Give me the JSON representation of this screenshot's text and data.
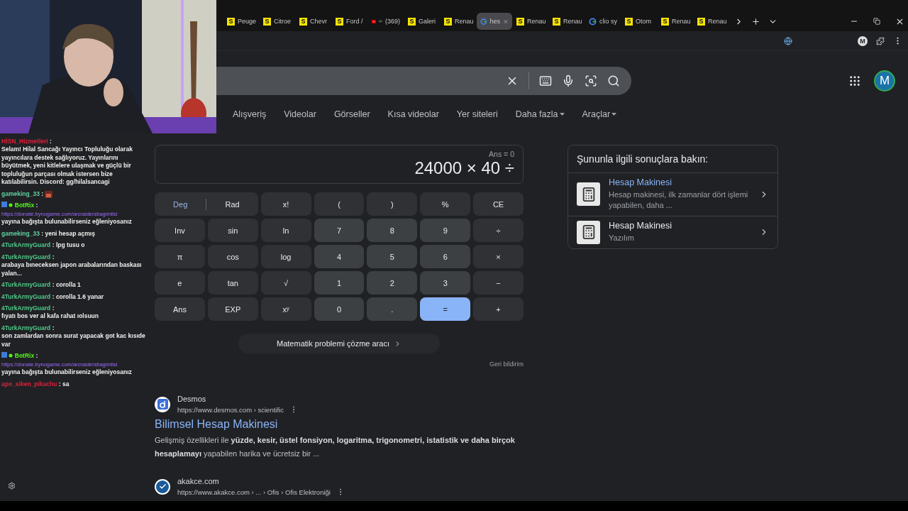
{
  "tabs": [
    {
      "kind": "site",
      "favicon": "S",
      "label": "Peuge",
      "selected": false
    },
    {
      "kind": "site",
      "favicon": "S",
      "label": "Citroe",
      "selected": false
    },
    {
      "kind": "site",
      "favicon": "S",
      "label": "Chevr",
      "selected": false
    },
    {
      "kind": "site",
      "favicon": "S",
      "label": "Ford /",
      "selected": false
    },
    {
      "kind": "video",
      "label": "(369)",
      "selected": false
    },
    {
      "kind": "site",
      "favicon": "S",
      "label": "Galeri",
      "selected": false
    },
    {
      "kind": "site",
      "favicon": "S",
      "label": "Renau",
      "selected": false
    },
    {
      "kind": "search",
      "label": "hes",
      "selected": true
    },
    {
      "kind": "site",
      "favicon": "S",
      "label": "Renau",
      "selected": false
    },
    {
      "kind": "site",
      "favicon": "S",
      "label": "Renau",
      "selected": false
    },
    {
      "kind": "search",
      "label": "clio sy",
      "selected": false
    },
    {
      "kind": "site",
      "favicon": "S",
      "label": "Otom",
      "selected": false
    },
    {
      "kind": "site",
      "favicon": "S",
      "label": "Renau",
      "selected": false
    },
    {
      "kind": "site",
      "favicon": "S",
      "label": "Renau",
      "selected": false
    }
  ],
  "profile_button": "M",
  "account_avatar": "M",
  "search_nav": [
    {
      "label": "Alışveriş",
      "dropdown": false
    },
    {
      "label": "Videolar",
      "dropdown": false
    },
    {
      "label": "Görseller",
      "dropdown": false
    },
    {
      "label": "Kısa videolar",
      "dropdown": false
    },
    {
      "label": "Yer siteleri",
      "dropdown": false
    },
    {
      "label": "Daha fazla",
      "dropdown": true
    },
    {
      "label": "Araçlar",
      "dropdown": true
    }
  ],
  "chat": [
    {
      "user": "HİSN_Hizmetleri",
      "color": "#e0203a",
      "separator": ":",
      "text": "Selam! Hilal Sancağı Yayıncı Topluluğu olarak yayıncılara destek sağlıyoruz. Yayınlarını büyütmek, yeni kitlelere ulaşmak ve güçlü bir topluluğun parçası olmak istersen bize katılabilirsin. Discord: gg/hilalsancagi"
    },
    {
      "user": "gameking_33",
      "color": "#5fd3a0",
      "separator": ":",
      "emote": true
    },
    {
      "user": "BotRix",
      "color": "#53fc18",
      "separator": ":",
      "bot": true,
      "link": "https://donate.bynogame.com/arcraidersbagimlisi",
      "text": "yayına bağışta bulunabilirseniz eğleniyosanız"
    },
    {
      "user": "gameking_33",
      "color": "#5fd3a0",
      "separator": ":",
      "text": "yeni hesap açmış"
    },
    {
      "user": "4TurkArmyGuard",
      "color": "#4fc98a",
      "separator": ":",
      "text": "lpg tusu o"
    },
    {
      "user": "4TurkArmyGuard",
      "color": "#4fc98a",
      "separator": ":",
      "text": "arabaya bıneceksen japon arabalarından baskası yalan..."
    },
    {
      "user": "4TurkArmyGuard",
      "color": "#4fc98a",
      "separator": ":",
      "text": "corolla 1"
    },
    {
      "user": "4TurkArmyGuard",
      "color": "#4fc98a",
      "separator": ":",
      "text": "corolla 1.6 yanar"
    },
    {
      "user": "4TurkArmyGuard",
      "color": "#4fc98a",
      "separator": ":",
      "text": "fıyatı bos ver al kafa rahat ıolsuun"
    },
    {
      "user": "4TurkArmyGuard",
      "color": "#4fc98a",
      "separator": ":",
      "text": "son zamlardan sonra surat yapacak got kac kısıde var"
    },
    {
      "user": "BotRix",
      "color": "#53fc18",
      "separator": ":",
      "bot": true,
      "link": "https://donate.bynogame.com/arcraidersbagimlisi",
      "text": "yayına bağışta bulunabilirseniz eğleniyosanız"
    },
    {
      "user": "apo_siken_pikachu",
      "color": "#e0203a",
      "separator": ":",
      "text": "sa"
    }
  ],
  "calculator": {
    "ans": "Ans = 0",
    "expression": "24000 × 40 ÷",
    "angle_modes": [
      {
        "label": "Deg",
        "selected": true
      },
      {
        "label": "Rad",
        "selected": false
      }
    ],
    "keys": [
      {
        "label": "x!",
        "kind": "fn"
      },
      {
        "label": "(",
        "kind": "fn"
      },
      {
        "label": ")",
        "kind": "fn"
      },
      {
        "label": "%",
        "kind": "fn"
      },
      {
        "label": "CE",
        "kind": "fn"
      },
      {
        "label": "Inv",
        "kind": "fn"
      },
      {
        "label": "sin",
        "kind": "fn"
      },
      {
        "label": "ln",
        "kind": "fn"
      },
      {
        "label": "7",
        "kind": "digit"
      },
      {
        "label": "8",
        "kind": "digit"
      },
      {
        "label": "9",
        "kind": "digit"
      },
      {
        "label": "÷",
        "kind": "fn"
      },
      {
        "label": "π",
        "kind": "fn"
      },
      {
        "label": "cos",
        "kind": "fn"
      },
      {
        "label": "log",
        "kind": "fn"
      },
      {
        "label": "4",
        "kind": "digit"
      },
      {
        "label": "5",
        "kind": "digit"
      },
      {
        "label": "6",
        "kind": "digit"
      },
      {
        "label": "×",
        "kind": "fn"
      },
      {
        "label": "e",
        "kind": "fn"
      },
      {
        "label": "tan",
        "kind": "fn"
      },
      {
        "label": "√",
        "kind": "fn"
      },
      {
        "label": "1",
        "kind": "digit"
      },
      {
        "label": "2",
        "kind": "digit"
      },
      {
        "label": "3",
        "kind": "digit"
      },
      {
        "label": "−",
        "kind": "fn"
      },
      {
        "label": "Ans",
        "kind": "fn"
      },
      {
        "label": "EXP",
        "kind": "fn"
      },
      {
        "label": "xʸ",
        "kind": "fn"
      },
      {
        "label": "0",
        "kind": "digit"
      },
      {
        "label": ".",
        "kind": "digit"
      },
      {
        "label": "=",
        "kind": "equals"
      },
      {
        "label": "+",
        "kind": "fn"
      }
    ],
    "solver": "Matematik problemi çözme aracı",
    "feedback": "Geri bildirim"
  },
  "results": [
    {
      "kind": "desmos",
      "site": "Desmos",
      "url": "https://www.desmos.com › scientific",
      "title": "Bilimsel Hesap Makinesi",
      "snippet": "Gelişmiş özellikleri ile **yüzde, kesir, üstel fonsiyon, logaritma, trigonometri, istatistik ve daha birçok hesaplamayı** yapabilen harika ve ücretsiz bir ..."
    },
    {
      "kind": "check",
      "site": "akakce.com",
      "url": "https://www.akakce.com › ... › Ofis › Ofis Elektroniği"
    }
  ],
  "related": {
    "heading": "Şununla ilgili sonuçlara bakın:",
    "items": [
      {
        "title": "Hesap Makinesi",
        "subtitle": "Hesap makinesi, ilk zamanlar dört işlemi yapabilen, daha ...",
        "color": "#8ab4f8"
      },
      {
        "title": "Hesap Makinesi",
        "subtitle": "Yazılım",
        "color": "#e8eaed"
      }
    ]
  }
}
